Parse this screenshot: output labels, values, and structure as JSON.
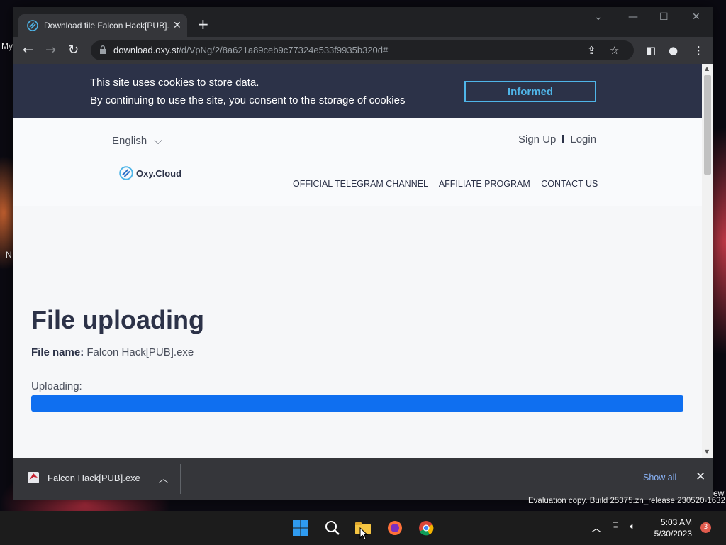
{
  "desktop": {
    "labels": [
      "My",
      "N"
    ],
    "watermark": "Evaluation copy. Build 25375.zn_release.230520-1632",
    "watermark_side": "ew"
  },
  "browser": {
    "tab": {
      "title": "Download file Falcon Hack[PUB].exe"
    },
    "window_controls": {
      "dropdown": "⌄",
      "minimize": "—",
      "maximize": "☐",
      "close": "✕"
    },
    "address": {
      "host": "download.oxy.st",
      "path": "/d/VpNg/2/8a621a89ceb9c77324e533f9935b320d#"
    }
  },
  "cookie_banner": {
    "line1": "This site uses cookies to store data.",
    "line2": "By continuing to use the site, you consent to the storage of cookies",
    "button": "Informed"
  },
  "site": {
    "language": "English",
    "logo": "Oxy.Cloud",
    "auth": {
      "signup": "Sign Up",
      "login": "Login"
    },
    "nav": [
      "OFFICIAL TELEGRAM CHANNEL",
      "AFFILIATE PROGRAM",
      "CONTACT US"
    ]
  },
  "upload": {
    "title": "File uploading",
    "file_label": "File name:",
    "file_name": "Falcon Hack[PUB].exe",
    "progress_label": "Uploading:",
    "progress_fraction": 1.0
  },
  "download_bar": {
    "item": "Falcon Hack[PUB].exe",
    "show_all": "Show all"
  },
  "taskbar": {
    "time": "5:03 AM",
    "date": "5/30/2023",
    "notifications": "3"
  },
  "colors": {
    "accent": "#0f6ff0",
    "banner": "#2c3248",
    "banner_button": "#4fb5e8"
  }
}
